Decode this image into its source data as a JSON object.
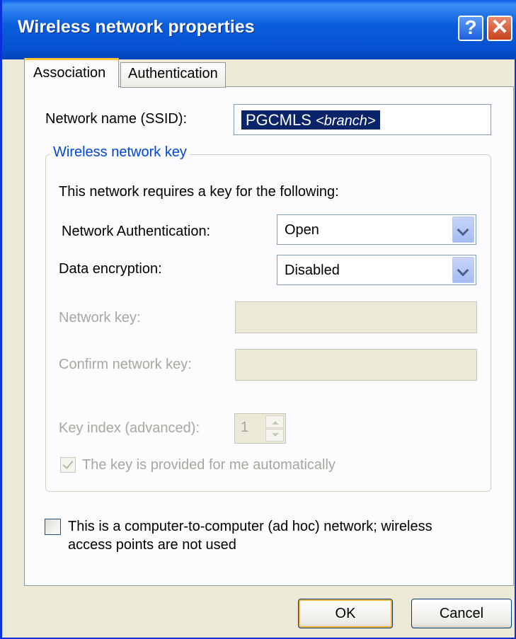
{
  "window": {
    "title": "Wireless network properties",
    "help_glyph": "?",
    "close_glyph": "✕"
  },
  "tabs": [
    {
      "label": "Association",
      "active": true
    },
    {
      "label": "Authentication",
      "active": false
    }
  ],
  "ssid": {
    "label": "Network name (SSID):",
    "value_main": "PGCMLS ",
    "value_italic": "<branch>"
  },
  "key_group": {
    "legend": "Wireless network key",
    "description": "This network requires a key for the following:",
    "auth": {
      "label": "Network Authentication:",
      "value": "Open"
    },
    "encryption": {
      "label": "Data encryption:",
      "value": "Disabled"
    },
    "network_key": {
      "label": "Network key:",
      "value": ""
    },
    "confirm_key": {
      "label": "Confirm network key:",
      "value": ""
    },
    "key_index": {
      "label": "Key index (advanced):",
      "value": "1"
    },
    "auto_key": {
      "label": "The key is provided for me automatically",
      "checked": true,
      "enabled": false
    }
  },
  "adhoc": {
    "label_line1": "This is a computer-to-computer (ad hoc) network; wireless",
    "label_line2": "access points are not used",
    "checked": false
  },
  "buttons": {
    "ok": "OK",
    "cancel": "Cancel"
  },
  "colors": {
    "titlebar": "#0a5ce6",
    "legend": "#0046d5",
    "selection": "#0a246a"
  }
}
